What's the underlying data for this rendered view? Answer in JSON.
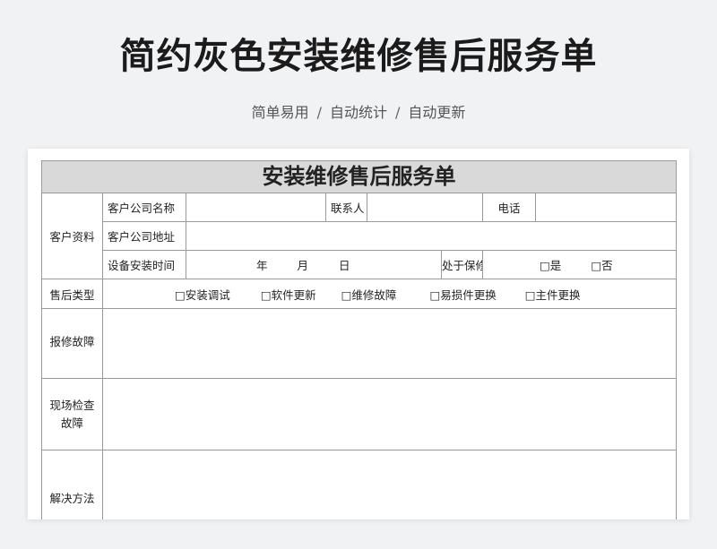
{
  "header": {
    "title": "简约灰色安装维修售后服务单",
    "tagline": [
      "简单易用",
      "自动统计",
      "自动更新"
    ],
    "separator": "/"
  },
  "form": {
    "title": "安装维修售后服务单",
    "section_customer": "客户资料",
    "company_name_label": "客户公司名称",
    "contact_label": "联系人",
    "phone_label": "电话",
    "address_label": "客户公司地址",
    "install_time_label": "设备安装时间",
    "date_year": "年",
    "date_month": "月",
    "date_day": "日",
    "warranty_label": "处于保修期",
    "warranty_yes": "□是",
    "warranty_no": "□否",
    "service_type_label": "售后类型",
    "service_types": [
      "□安装调试",
      "□软件更新",
      "□维修故障",
      "□易损件更换",
      "□主件更换"
    ],
    "fault_report_label": "报修故障",
    "onsite_label_line1": "现场检查",
    "onsite_label_line2": "故障",
    "solution_label": "解决方法"
  }
}
